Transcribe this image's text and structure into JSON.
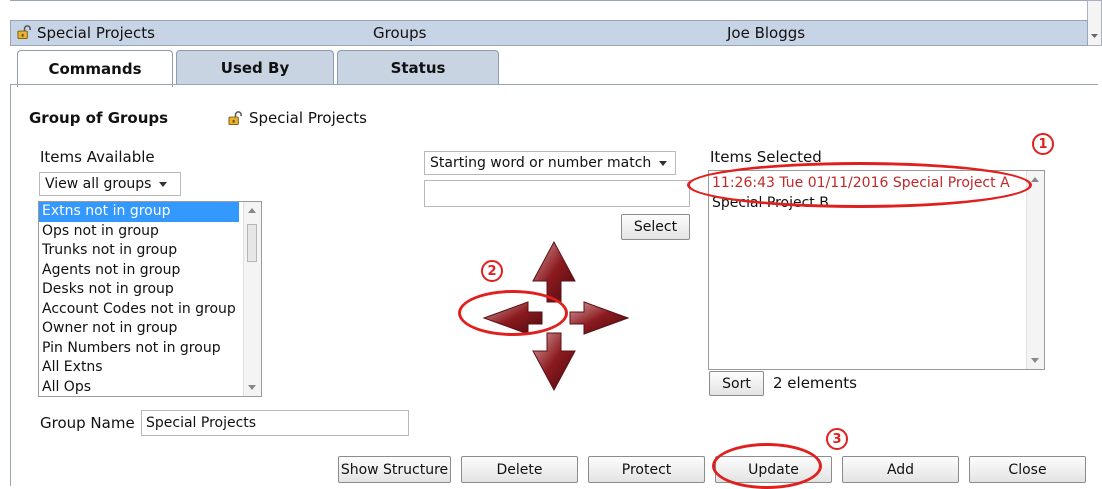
{
  "header": {
    "title": "Special Projects",
    "section": "Groups",
    "user": "Joe Bloggs"
  },
  "tabs": [
    {
      "label": "Commands",
      "active": true
    },
    {
      "label": "Used By",
      "active": false
    },
    {
      "label": "Status",
      "active": false
    }
  ],
  "form": {
    "group_of_groups_label": "Group of Groups",
    "group_of_groups_value": "Special Projects",
    "items_available_label": "Items Available",
    "view_filter": "View all groups",
    "available_items": [
      "Extns not in group",
      "Ops not in group",
      "Trunks not in group",
      "Agents not in group",
      "Desks not in group",
      "Account Codes not in group",
      "Owner not in group",
      "Pin Numbers not in group",
      "All Extns",
      "All Ops"
    ],
    "match_mode": "Starting word or number match",
    "match_input": "",
    "select_label": "Select",
    "items_selected_label": "Items Selected",
    "selected_items": [
      "11:26:43 Tue 01/11/2016 Special Project A",
      "Special Project B"
    ],
    "sort_label": "Sort",
    "element_count": "2 elements",
    "group_name_label": "Group Name",
    "group_name_value": "Special Projects"
  },
  "buttons": {
    "show_structure": "Show Structure",
    "delete": "Delete",
    "protect": "Protect",
    "update": "Update",
    "add": "Add",
    "close": "Close"
  },
  "callouts": [
    "1",
    "2",
    "3"
  ],
  "colors": {
    "header_bg": "#c7d4e6",
    "selected_row_bg": "#3399ff",
    "highlight_text": "#c0282a",
    "arrow": "#8b1a1f",
    "callout": "#e0201e"
  }
}
